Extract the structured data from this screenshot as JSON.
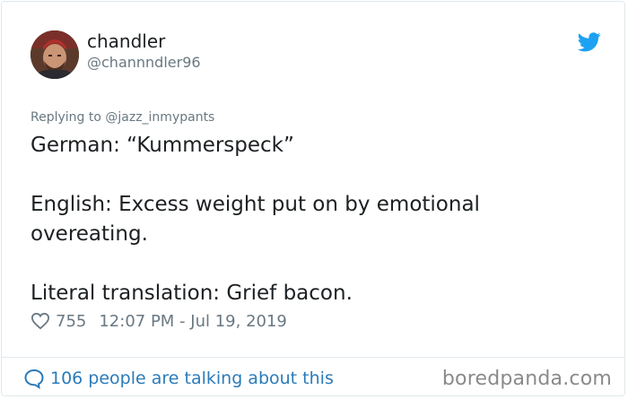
{
  "author": {
    "display_name": "chandler",
    "handle": "@channndler96",
    "avatar_icon": "user-avatar"
  },
  "reply": {
    "text": "Replying to @jazz_inmypants"
  },
  "tweet": {
    "line1": "German: “Kummerspeck”",
    "line2": "English: Excess weight put on by emotional overeating.",
    "line3": "Literal translation: Grief bacon."
  },
  "meta": {
    "likes": "755",
    "timestamp": "12:07 PM - Jul 19, 2019"
  },
  "footer": {
    "talking": "106 people are talking about this",
    "watermark": "boredpanda.com"
  },
  "colors": {
    "twitter_blue": "#1da1f2",
    "link_blue": "#2b7bb9",
    "text": "#1c2022",
    "muted": "#697882"
  },
  "icons": [
    "twitter-bird-icon",
    "heart-icon",
    "speech-bubble-icon"
  ]
}
